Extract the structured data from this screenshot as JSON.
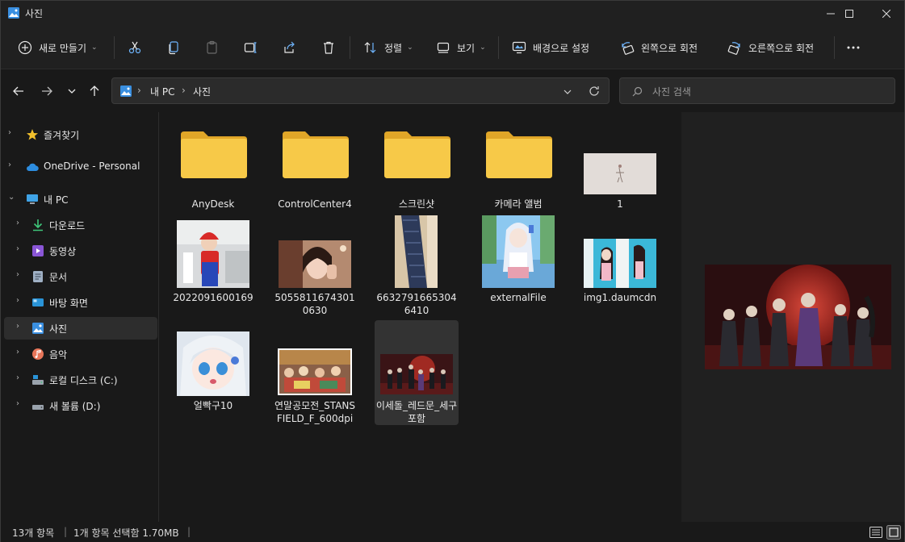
{
  "window": {
    "title": "사진"
  },
  "toolbar": {
    "new_label": "새로 만들기",
    "sort_label": "정렬",
    "view_label": "보기",
    "set_background_label": "배경으로 설정",
    "rotate_left_label": "왼쪽으로 회전",
    "rotate_right_label": "오른쪽으로 회전"
  },
  "address": {
    "crumbs": [
      "내 PC",
      "사진"
    ]
  },
  "search": {
    "placeholder": "사진 검색"
  },
  "sidebar": {
    "items": [
      {
        "label": "즐겨찾기",
        "icon": "star-icon"
      },
      {
        "label": "OneDrive - Personal",
        "icon": "cloud-icon"
      },
      {
        "label": "내 PC",
        "icon": "pc-icon"
      },
      {
        "label": "다운로드",
        "icon": "download-icon"
      },
      {
        "label": "동영상",
        "icon": "video-icon"
      },
      {
        "label": "문서",
        "icon": "document-icon"
      },
      {
        "label": "바탕 화면",
        "icon": "desktop-icon"
      },
      {
        "label": "사진",
        "icon": "pictures-icon"
      },
      {
        "label": "음악",
        "icon": "music-icon"
      },
      {
        "label": "로컬 디스크 (C:)",
        "icon": "drive-icon"
      },
      {
        "label": "새 볼륨 (D:)",
        "icon": "drive-icon"
      }
    ]
  },
  "files": [
    {
      "name": "AnyDesk",
      "type": "folder"
    },
    {
      "name": "ControlCenter4",
      "type": "folder"
    },
    {
      "name": "스크린샷",
      "type": "folder"
    },
    {
      "name": "카메라 앨범",
      "type": "folder"
    },
    {
      "name": "1",
      "type": "image"
    },
    {
      "name": "2022091600169",
      "type": "image"
    },
    {
      "name": "50558116743010630",
      "type": "image"
    },
    {
      "name": "66327916653046410",
      "type": "image"
    },
    {
      "name": "externalFile",
      "type": "image"
    },
    {
      "name": "img1.daumcdn",
      "type": "image"
    },
    {
      "name": "얼빡구10",
      "type": "image"
    },
    {
      "name": "연말공모전_STANSFIELD_F_600dpi",
      "type": "image"
    },
    {
      "name": "이세돌_레드문_세구포함",
      "type": "image"
    }
  ],
  "status": {
    "item_count": "13개 항목",
    "selection": "1개 항목 선택함 1.70MB"
  },
  "colors": {
    "folder": "#f7c948",
    "accent": "#4cc2ff",
    "background": "#191919"
  }
}
